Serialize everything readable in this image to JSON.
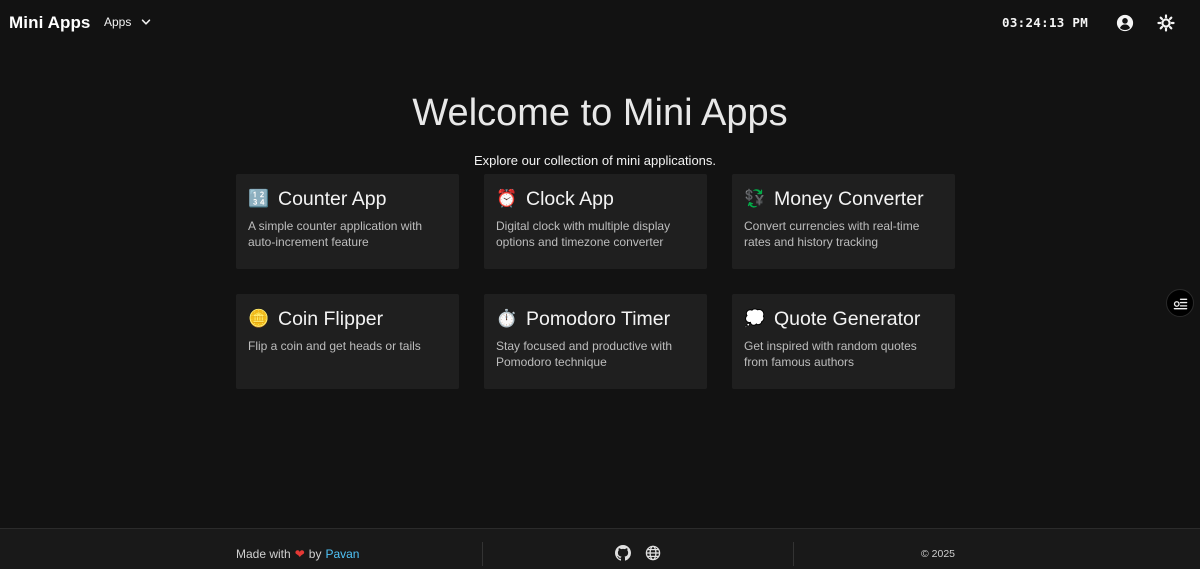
{
  "header": {
    "brand": "Mini Apps",
    "apps_menu_label": "Apps",
    "clock_time": "03:24:13 PM",
    "icons": {
      "user": "user-circle-icon",
      "theme": "sun-icon",
      "dropdown": "chevron-down-icon"
    }
  },
  "hero": {
    "title": "Welcome to Mini Apps",
    "subtitle": "Explore our collection of mini applications."
  },
  "cards": [
    {
      "icon": "🔢",
      "icon_name": "number-keycap-icon",
      "title": "Counter App",
      "description": "A simple counter application with auto-increment feature"
    },
    {
      "icon": "⏰",
      "icon_name": "alarm-clock-icon",
      "title": "Clock App",
      "description": "Digital clock with multiple display options and timezone converter"
    },
    {
      "icon": "💱",
      "icon_name": "currency-exchange-icon",
      "title": "Money Converter",
      "description": "Convert currencies with real-time rates and history tracking"
    },
    {
      "icon": "🪙",
      "icon_name": "coin-icon",
      "title": "Coin Flipper",
      "description": "Flip a coin and get heads or tails"
    },
    {
      "icon": "⏱️",
      "icon_name": "stopwatch-icon",
      "title": "Pomodoro Timer",
      "description": "Stay focused and productive with Pomodoro technique"
    },
    {
      "icon": "💭",
      "icon_name": "thought-bubble-icon",
      "title": "Quote Generator",
      "description": "Get inspired with random quotes from famous authors"
    }
  ],
  "side_button": {
    "icon": "list-settings-icon"
  },
  "footer": {
    "made_with": "Made with",
    "heart": "❤",
    "by": "by",
    "author": "Pavan",
    "copyright": "© 2025",
    "icons": [
      "github-icon",
      "globe-icon"
    ]
  },
  "colors": {
    "background": "#121212",
    "card": "#1f1f1f",
    "footer": "#191919",
    "link": "#4fc3f7",
    "heart": "#e53935"
  }
}
